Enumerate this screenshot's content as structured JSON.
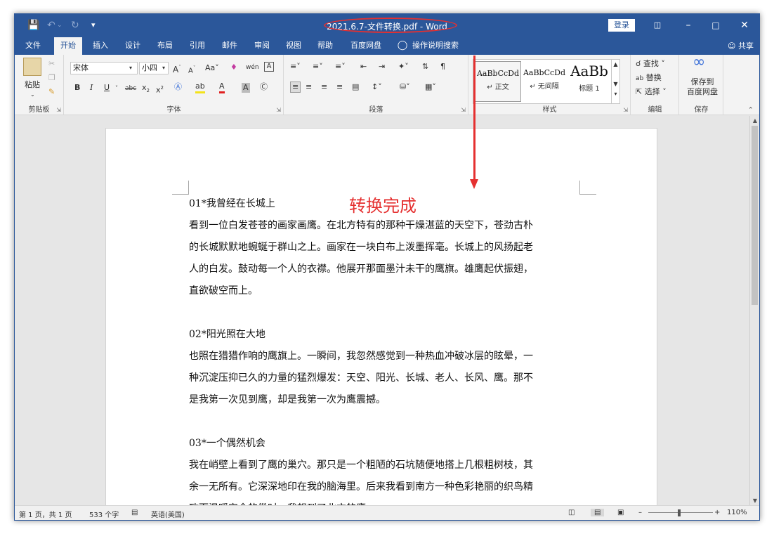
{
  "titlebar": {
    "title": "2021.6.7-文件转换.pdf  -  Word",
    "login": "登录"
  },
  "tabs": [
    "文件",
    "开始",
    "插入",
    "设计",
    "布局",
    "引用",
    "邮件",
    "审阅",
    "视图",
    "帮助",
    "百度网盘"
  ],
  "tell_me": "操作说明搜索",
  "share": "共享",
  "ribbon": {
    "clipboard": {
      "paste": "粘贴",
      "label": "剪贴板"
    },
    "font": {
      "font_name": "宋体",
      "font_size": "小四",
      "label": "字体"
    },
    "paragraph": {
      "label": "段落"
    },
    "styles": {
      "label": "样式",
      "items": [
        {
          "sample": "AaBbCcDd",
          "name": "正文"
        },
        {
          "sample": "AaBbCcDd",
          "name": "无间隔"
        },
        {
          "sample": "AaBb",
          "name": "标题 1"
        }
      ]
    },
    "editing": {
      "find": "查找",
      "replace": "替换",
      "select": "选择",
      "label": "编辑"
    },
    "save": {
      "line1": "保存到",
      "line2": "百度网盘",
      "label": "保存"
    }
  },
  "annotation": "转换完成",
  "document": {
    "lines": [
      "01*我曾经在长城上",
      "看到一位白发苍苍的画家画鹰。在北方特有的那种干燥湛蓝的天空下，苍劲古朴",
      "的长城默默地蜿蜒于群山之上。画家在一块白布上泼墨挥毫。长城上的风扬起老",
      "人的白发。鼓动每一个人的衣襟。他展开那面墨汁未干的鹰旗。雄鹰起伏振翅，",
      "直欲破空而上。",
      "02*阳光照在大地",
      "也照在猎猎作响的鹰旗上。一瞬间，我忽然感觉到一种热血冲破冰层的眩晕，一",
      "种沉淀压抑已久的力量的猛烈爆发：天空、阳光、长城、老人、长风、鹰。那不",
      "是我第一次见到鹰，却是我第一次为鹰震撼。",
      "03*一个偶然机会",
      "我在峭壁上看到了鹰的巢穴。那只是一个粗陋的石坑随便地搭上几根粗树枝，其",
      "余一无所有。它深深地印在我的脑海里。后来我看到南方一种色彩艳丽的织鸟精",
      "致而温暖安全的巢时，我想到了北方的鹰。"
    ]
  },
  "statusbar": {
    "page": "第 1 页，共 1 页",
    "words": "533 个字",
    "language": "英语(美国)",
    "zoom": "110%"
  }
}
